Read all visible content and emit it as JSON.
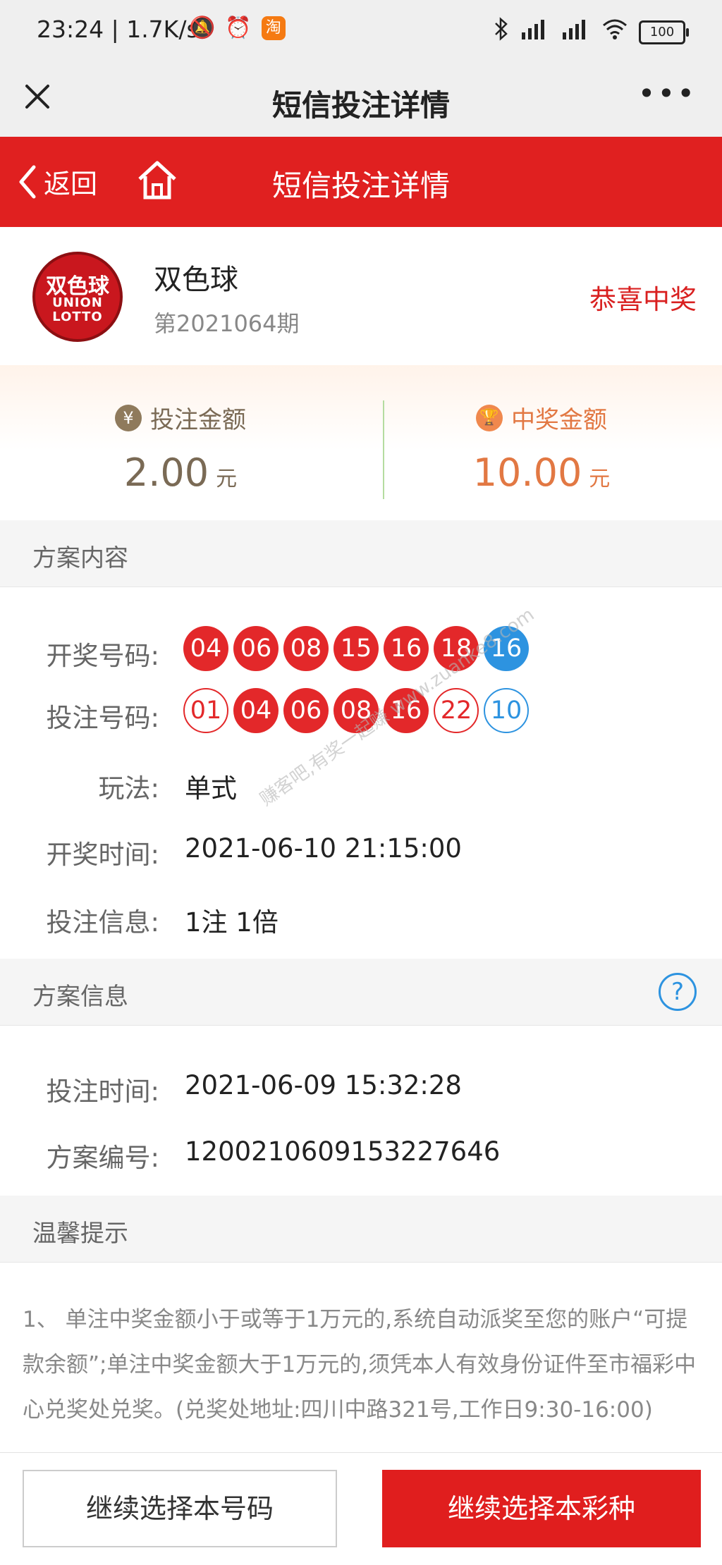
{
  "status_bar": {
    "time": "23:24 | 1.7K/s",
    "taobao_badge": "淘",
    "battery": "100"
  },
  "navbar": {
    "title": "短信投注详情",
    "more": "•••"
  },
  "header": {
    "back_label": "返回",
    "title": "短信投注详情",
    "bg_color": "#e02020"
  },
  "lottery": {
    "name": "双色球",
    "issue": "第2021064期",
    "status": "恭喜中奖",
    "logo_text_cn": "双色球",
    "logo_text_en1": "UNION",
    "logo_text_en2": "LOTTO"
  },
  "amounts": {
    "bet_label": "投注金额",
    "bet_value": "2.00",
    "bet_unit": "元",
    "bet_icon": "¥",
    "prize_label": "中奖金额",
    "prize_value": "10.00",
    "prize_unit": "元",
    "prize_icon": "🏆"
  },
  "plan_content": {
    "section_title": "方案内容",
    "draw_label": "开奖号码:",
    "draw_numbers": {
      "red": [
        "04",
        "06",
        "08",
        "15",
        "16",
        "18"
      ],
      "blue": [
        "16"
      ]
    },
    "bet_label": "投注号码:",
    "bet_numbers": [
      {
        "num": "01",
        "style": "red-o"
      },
      {
        "num": "04",
        "style": "red"
      },
      {
        "num": "06",
        "style": "red"
      },
      {
        "num": "08",
        "style": "red"
      },
      {
        "num": "16",
        "style": "red"
      },
      {
        "num": "22",
        "style": "red-o"
      },
      {
        "num": "10",
        "style": "blue-o"
      }
    ],
    "play_label": "玩法:",
    "play_value": "单式",
    "draw_time_label": "开奖时间:",
    "draw_time_value": "2021-06-10 21:15:00",
    "bet_info_label": "投注信息:",
    "bet_info_value": "1注 1倍"
  },
  "plan_info": {
    "section_title": "方案信息",
    "help_icon": "?",
    "bet_time_label": "投注时间:",
    "bet_time_value": "2021-06-09 15:32:28",
    "plan_no_label": "方案编号:",
    "plan_no_value": "1200210609153227646"
  },
  "tips": {
    "section_title": "温馨提示",
    "text": "1、 单注中奖金额小于或等于1万元的,系统自动派奖至您的账户“可提款余额”;单注中奖金额大于1万元的,须凭本人有效身份证件至市福彩中心兑奖处兑奖。(兑奖处地址:四川中路321号,工作日9:30-16:00)"
  },
  "watermark": "赚客吧,有奖一起赚 www.zuanke8.com",
  "bottom": {
    "btn_same_numbers": "继续选择本号码",
    "btn_same_lottery": "继续选择本彩种"
  }
}
